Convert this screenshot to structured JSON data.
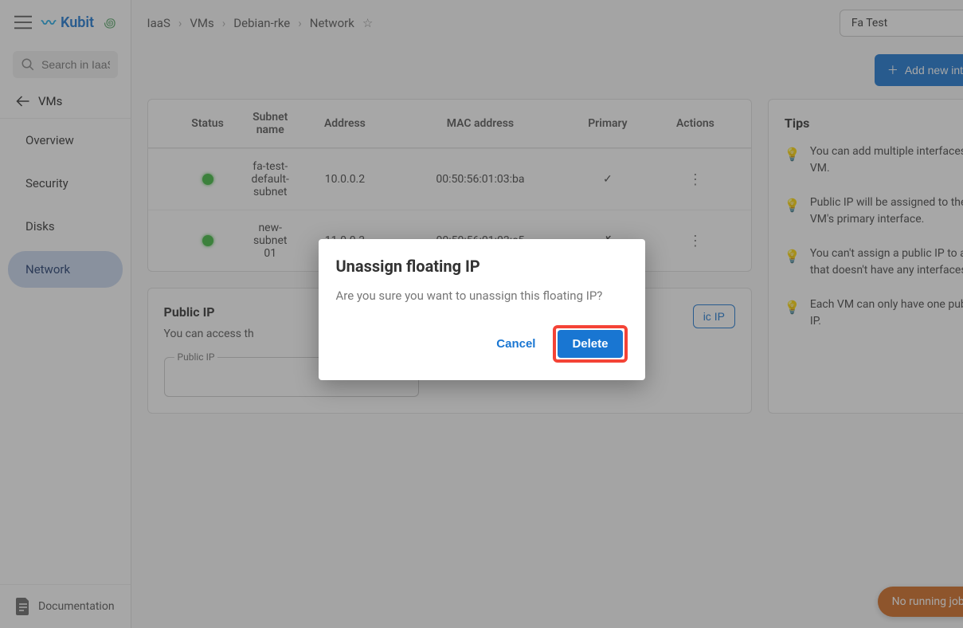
{
  "logo": {
    "text": "Kubit"
  },
  "search": {
    "placeholder": "Search in IaaS"
  },
  "back_label": "VMs",
  "sidebar": {
    "items": [
      {
        "label": "Overview"
      },
      {
        "label": "Security"
      },
      {
        "label": "Disks"
      },
      {
        "label": "Network"
      }
    ],
    "doc_label": "Documentation"
  },
  "breadcrumb": [
    "IaaS",
    "VMs",
    "Debian-rke",
    "Network"
  ],
  "project_select": {
    "value": "Fa Test"
  },
  "add_interface_label": "Add new interface",
  "table": {
    "headers": [
      "Status",
      "Subnet name",
      "Address",
      "MAC address",
      "Primary",
      "Actions"
    ],
    "rows": [
      {
        "subnet": "fa-test-default-subnet",
        "address": "10.0.0.2",
        "mac": "00:50:56:01:03:ba",
        "primary": "✓"
      },
      {
        "subnet": "new-subnet 01",
        "address": "11.0.0.3",
        "mac": "00:50:56:01:03:c5",
        "primary": "✗"
      }
    ]
  },
  "public_ip": {
    "title": "Public IP",
    "desc": "You can access th",
    "legend": "Public IP",
    "assign_btn_suffix": "ic IP"
  },
  "tips": {
    "title": "Tips",
    "items": [
      "You can add multiple interfaces to a VM.",
      "Public IP will be assigned to the VM's primary interface.",
      "You can't assign a public IP to a VM that doesn't have any interfaces.",
      "Each VM can only have one public IP."
    ]
  },
  "jobs_pill": "No running jobs",
  "modal": {
    "title": "Unassign floating IP",
    "text": "Are you sure you want to unassign this floating IP?",
    "cancel": "Cancel",
    "delete": "Delete"
  }
}
